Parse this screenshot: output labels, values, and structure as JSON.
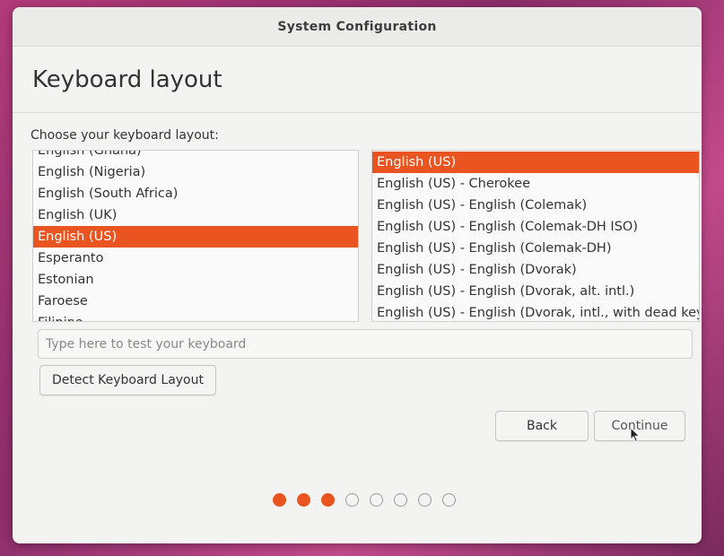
{
  "window": {
    "title": "System Configuration"
  },
  "page": {
    "heading": "Keyboard layout",
    "prompt": "Choose your keyboard layout:"
  },
  "layouts": {
    "items": [
      {
        "label": "English (Ghana)",
        "selected": false
      },
      {
        "label": "English (Nigeria)",
        "selected": false
      },
      {
        "label": "English (South Africa)",
        "selected": false
      },
      {
        "label": "English (UK)",
        "selected": false
      },
      {
        "label": "English (US)",
        "selected": true
      },
      {
        "label": "Esperanto",
        "selected": false
      },
      {
        "label": "Estonian",
        "selected": false
      },
      {
        "label": "Faroese",
        "selected": false
      },
      {
        "label": "Filipino",
        "selected": false
      }
    ]
  },
  "variants": {
    "items": [
      {
        "label": "English (US)",
        "selected": true
      },
      {
        "label": "English (US) - Cherokee",
        "selected": false
      },
      {
        "label": "English (US) - English (Colemak)",
        "selected": false
      },
      {
        "label": "English (US) - English (Colemak-DH ISO)",
        "selected": false
      },
      {
        "label": "English (US) - English (Colemak-DH)",
        "selected": false
      },
      {
        "label": "English (US) - English (Dvorak)",
        "selected": false
      },
      {
        "label": "English (US) - English (Dvorak, alt. intl.)",
        "selected": false
      },
      {
        "label": "English (US) - English (Dvorak, intl., with dead keys)",
        "selected": false
      }
    ]
  },
  "test_field": {
    "placeholder": "Type here to test your keyboard",
    "value": ""
  },
  "buttons": {
    "detect": "Detect Keyboard Layout",
    "back": "Back",
    "continue": "Continue"
  },
  "progress": {
    "total_steps": 8,
    "completed_steps": 3
  },
  "colors": {
    "accent": "#e95420",
    "window_bg": "#f3f3f1"
  }
}
